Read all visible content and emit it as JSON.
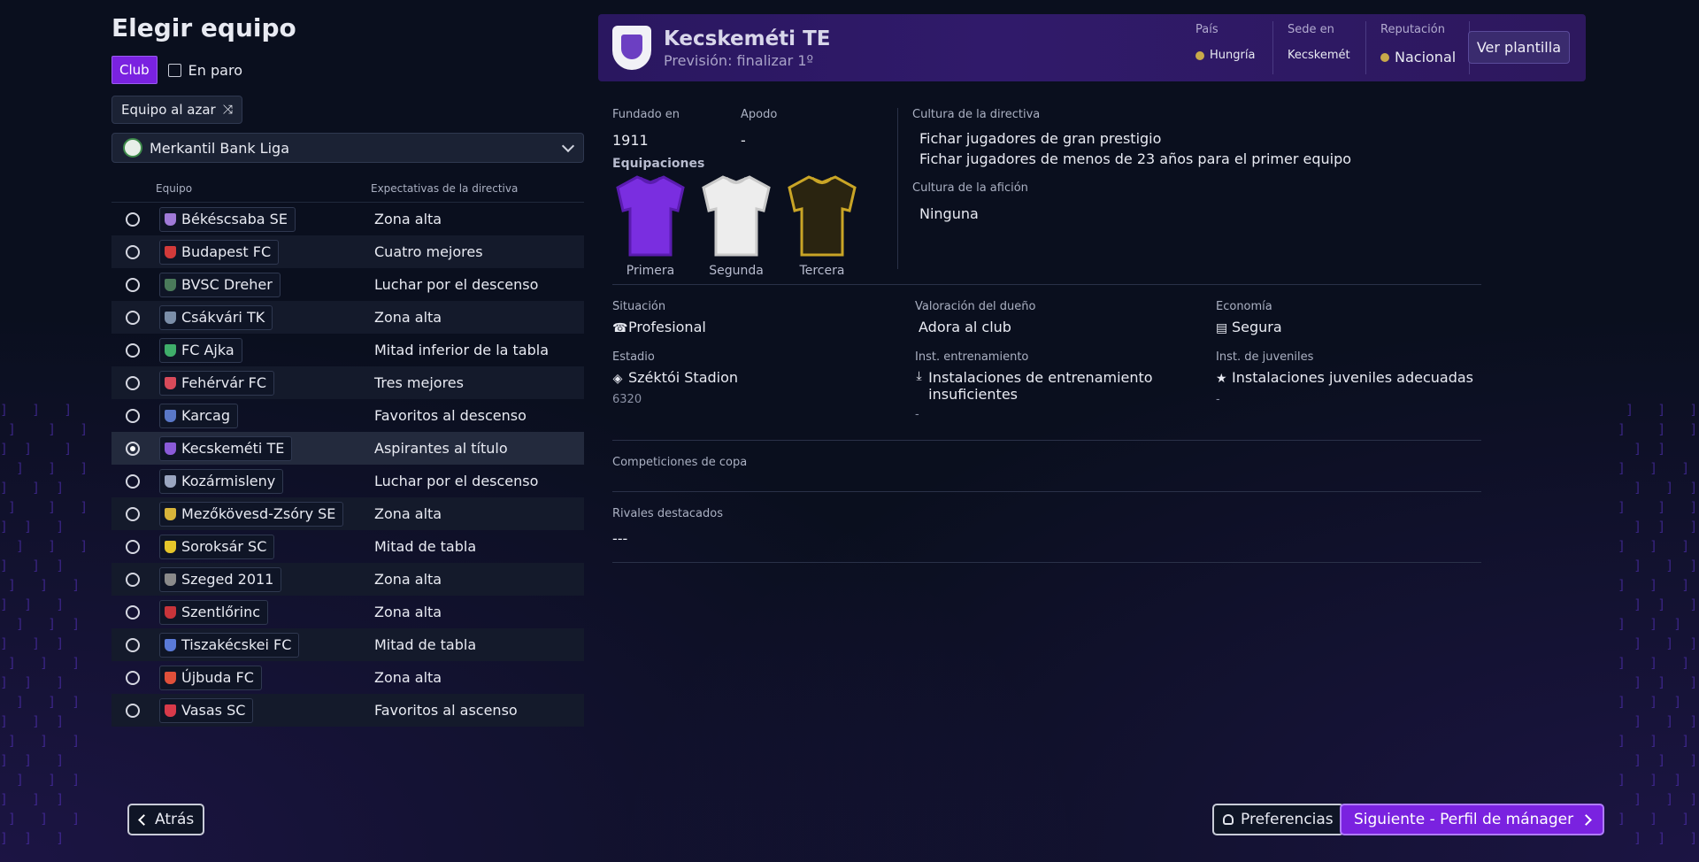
{
  "page": {
    "title": "Elegir equipo",
    "filter_club": "Club",
    "filter_unemployed": "En paro",
    "random_button": "Equipo al azar",
    "league": "Merkantil Bank Liga"
  },
  "table": {
    "col_team": "Equipo",
    "col_expectations": "Expectativas de la directiva",
    "rows": [
      {
        "team": "Békéscsaba SE",
        "exp": "Zona alta",
        "color": "#a07ad8"
      },
      {
        "team": "Budapest FC",
        "exp": "Cuatro mejores",
        "color": "#d23a3a"
      },
      {
        "team": "BVSC Dreher",
        "exp": "Luchar por el descenso",
        "color": "#4a7a5a"
      },
      {
        "team": "Csákvári TK",
        "exp": "Zona alta",
        "color": "#7b8ea8"
      },
      {
        "team": "FC Ajka",
        "exp": "Mitad inferior de la tabla",
        "color": "#3fae6a"
      },
      {
        "team": "Fehérvár FC",
        "exp": "Tres mejores",
        "color": "#d84a5a"
      },
      {
        "team": "Karcag",
        "exp": "Favoritos al descenso",
        "color": "#5a78c8"
      },
      {
        "team": "Kecskeméti TE",
        "exp": "Aspirantes al título",
        "color": "#8a5ad8"
      },
      {
        "team": "Kozármisleny",
        "exp": "Luchar por el descenso",
        "color": "#9aa6c0"
      },
      {
        "team": "Mezőkövesd-Zsóry SE",
        "exp": "Zona alta",
        "color": "#d8b43a"
      },
      {
        "team": "Soroksár SC",
        "exp": "Mitad de tabla",
        "color": "#e6c62a"
      },
      {
        "team": "Szeged 2011",
        "exp": "Zona alta",
        "color": "#8a8a8a"
      },
      {
        "team": "Szentlőrinc",
        "exp": "Zona alta",
        "color": "#c8343a"
      },
      {
        "team": "Tiszakécskei FC",
        "exp": "Mitad de tabla",
        "color": "#5a7ad8"
      },
      {
        "team": "Újbuda FC",
        "exp": "Zona alta",
        "color": "#e0503a"
      },
      {
        "team": "Vasas SC",
        "exp": "Favoritos al ascenso",
        "color": "#d83a4a"
      }
    ],
    "selected_index": 7
  },
  "club": {
    "name": "Kecskeméti TE",
    "forecast": "Previsión: finalizar 1º",
    "country_label": "País",
    "country": "Hungría",
    "seat_label": "Sede en",
    "seat": "Kecskemét",
    "reputation_label": "Reputación",
    "reputation": "Nacional",
    "squad_button": "Ver plantilla",
    "founded_label": "Fundado en",
    "founded": "1911",
    "nickname_label": "Apodo",
    "nickname": "-",
    "kits_label": "Equipaciones",
    "kits": [
      {
        "label": "Primera",
        "body": "#7a2ee0",
        "trim": "#5a1cb0"
      },
      {
        "label": "Segunda",
        "body": "#ededed",
        "trim": "#c9c9c9"
      },
      {
        "label": "Tercera",
        "body": "#2a2410",
        "trim": "#c9a526"
      }
    ],
    "board_culture_label": "Cultura de la directiva",
    "board_culture": [
      "Fichar jugadores de gran prestigio",
      "Fichar jugadores de menos de 23 años para el primer equipo"
    ],
    "fan_culture_label": "Cultura de la afición",
    "fan_culture": "Ninguna",
    "status_label": "Situación",
    "status": "Profesional",
    "owner_label": "Valoración del dueño",
    "owner": "Adora al club",
    "economy_label": "Economía",
    "economy": "Segura",
    "stadium_label": "Estadio",
    "stadium": "Széktói Stadion",
    "stadium_capacity": "6320",
    "training_label": "Inst. entrenamiento",
    "training": "Instalaciones de entrenamiento insuficientes",
    "training_sub": "-",
    "youth_label": "Inst. de juveniles",
    "youth": "Instalaciones juveniles adecuadas",
    "youth_sub": "-",
    "cups_label": "Competiciones de copa",
    "rivals_label": "Rivales destacados",
    "rivals": "---"
  },
  "footer": {
    "back": "Atrás",
    "preferences": "Preferencias",
    "next": "Siguiente - Perfil de mánager"
  },
  "colors": {
    "accent": "#7a22e0",
    "header": "#2a1760"
  }
}
